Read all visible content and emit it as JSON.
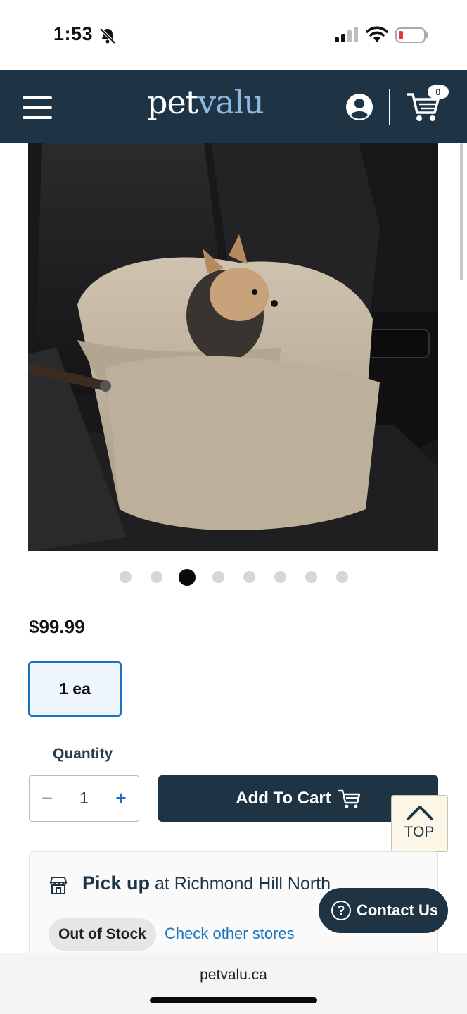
{
  "status_bar": {
    "time": "1:53"
  },
  "header": {
    "logo_pet": "pet",
    "logo_valu": "valu",
    "cart_count": "0"
  },
  "carousel": {
    "total_dots": 8,
    "active_index": 2
  },
  "product": {
    "price": "$99.99",
    "size_option": "1 ea"
  },
  "quantity": {
    "label": "Quantity",
    "value": "1",
    "minus": "−",
    "plus": "+"
  },
  "actions": {
    "add_to_cart": "Add To Cart",
    "top_label": "TOP"
  },
  "pickup": {
    "title_strong": "Pick up",
    "title_rest": " at Richmond Hill North",
    "stock_status": "Out of Stock",
    "check_other": "Check other stores"
  },
  "contact": {
    "label": "Contact Us",
    "icon_glyph": "?"
  },
  "browser": {
    "url": "petvalu.ca"
  },
  "colors": {
    "brand_navy": "#1e3444",
    "link_blue": "#1a73c2",
    "logo_blue": "#8fb8e0"
  }
}
